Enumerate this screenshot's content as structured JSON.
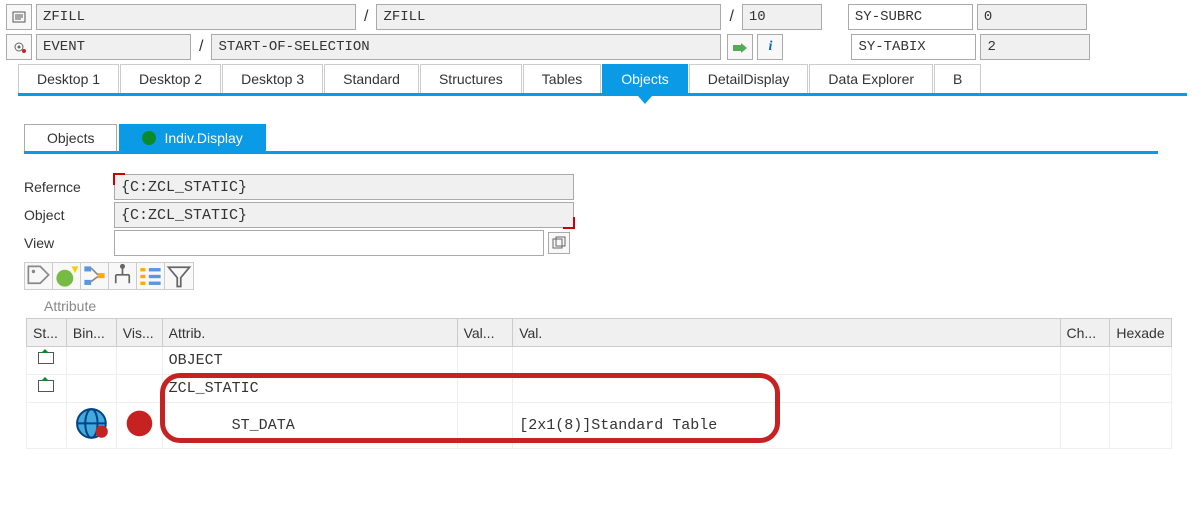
{
  "header": {
    "row1": {
      "program1": "ZFILL",
      "program2": "ZFILL",
      "line": "10",
      "sy_subrc_label": "SY-SUBRC",
      "sy_subrc_value": "0"
    },
    "row2": {
      "event": "EVENT",
      "section": "START-OF-SELECTION",
      "sy_tabix_label": "SY-TABIX",
      "sy_tabix_value": "2"
    }
  },
  "mainTabs": [
    "Desktop 1",
    "Desktop 2",
    "Desktop 3",
    "Standard",
    "Structures",
    "Tables",
    "Objects",
    "DetailDisplay",
    "Data Explorer",
    "B"
  ],
  "mainTabActive": "Objects",
  "subTabs": {
    "t1": "Objects",
    "t2": "Indiv.Display"
  },
  "form": {
    "refLabel": "Refernce",
    "refValue": "{C:ZCL_STATIC}",
    "objLabel": "Object",
    "objValue": "{C:ZCL_STATIC}",
    "viewLabel": "View",
    "viewValue": ""
  },
  "attrTitle": "Attribute",
  "columns": {
    "c1": "St...",
    "c2": "Bin...",
    "c3": "Vis...",
    "c4": "Attrib.",
    "c5": "Val...",
    "c6": "Val.",
    "c7": "Ch...",
    "c8": "Hexade"
  },
  "rows": [
    {
      "attrib": "OBJECT",
      "val1": "",
      "val2": ""
    },
    {
      "attrib": "ZCL_STATIC",
      "val1": "",
      "val2": ""
    },
    {
      "attrib": "       ST_DATA",
      "val1": "",
      "val2": "[2x1(8)]Standard Table"
    }
  ]
}
